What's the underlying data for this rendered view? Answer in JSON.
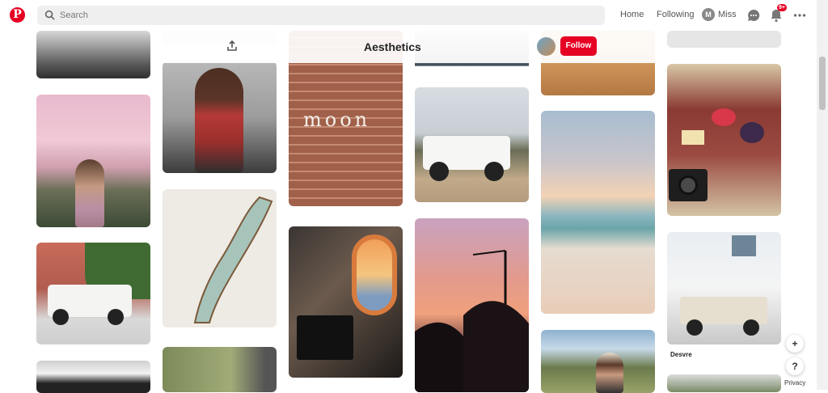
{
  "header": {
    "search_placeholder": "Search",
    "nav": {
      "home": "Home",
      "following": "Following",
      "profile_name": "Miss",
      "avatar_initial": "M"
    },
    "notifications_badge": "9+"
  },
  "board": {
    "title": "Aesthetics",
    "follow_label": "Follow"
  },
  "pins": {
    "moon_text": "moon",
    "desvre_caption": "Desvre"
  },
  "floating": {
    "add_label": "+",
    "help_label": "?",
    "privacy_label": "Privacy"
  },
  "colors": {
    "brand": "#e60023",
    "search_bg": "#efefef"
  }
}
